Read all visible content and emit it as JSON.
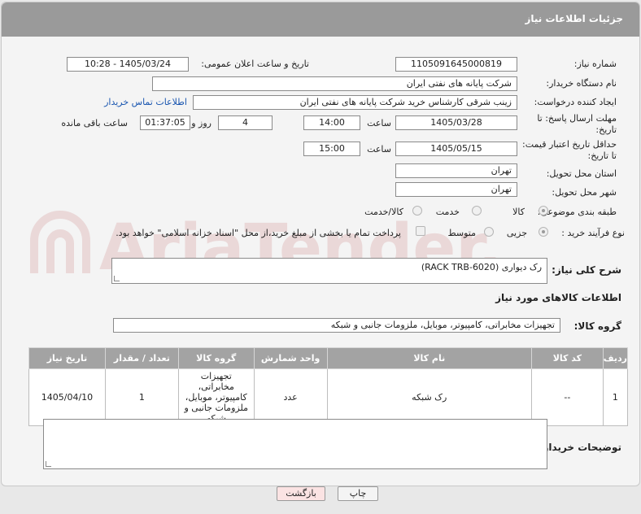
{
  "header": {
    "title": "جزئیات اطلاعات نیاز"
  },
  "fields": {
    "need_number_label": "شماره نیاز:",
    "need_number": "1105091645000819",
    "announce_label": "تاریخ و ساعت اعلان عمومی:",
    "announce_value": "1405/03/24 - 10:28",
    "buyer_label": "نام دستگاه خریدار:",
    "buyer_value": "شرکت پایانه های نفتی ایران",
    "creator_label": "ایجاد کننده درخواست:",
    "creator_value": "زینب  شرقی  کارشناس خرید شرکت پایانه های نفتی ایران",
    "contact_link": "اطلاعات تماس خریدار",
    "deadline_label_1": "مهلت ارسال پاسخ: تا",
    "deadline_label_2": "تاریخ:",
    "deadline_date": "1405/03/28",
    "time_label": "ساعت",
    "deadline_time": "14:00",
    "days_value": "4",
    "days_label": "روز و",
    "remaining_value": "01:37:05",
    "remaining_label": "ساعت باقی مانده",
    "validity_label_1": "حداقل تاریخ اعتبار قیمت:",
    "validity_label_2": "تا تاریخ:",
    "validity_date": "1405/05/15",
    "validity_time": "15:00",
    "province_label": "استان محل تحویل:",
    "province_value": "تهران",
    "city_label": "شهر محل تحویل:",
    "city_value": "تهران",
    "category_label": "طبقه بندی موضوعی:",
    "category_options": [
      "کالا",
      "خدمت",
      "کالا/خدمت"
    ],
    "process_label": "نوع فرآیند خرید :",
    "process_options": [
      "جزیی",
      "متوسط"
    ],
    "payment_note": "پرداخت تمام یا بخشی از مبلغ خرید،از محل \"اسناد خزانه اسلامی\" خواهد بود."
  },
  "description": {
    "label": "شرح کلی نیاز:",
    "value": "رک دیواری (RACK TRB-6020)"
  },
  "goods_section": {
    "title": "اطلاعات کالاهای مورد نیاز",
    "group_label": "گروه کالا:",
    "group_value": "تجهیزات مخابراتی، کامپیوتر، موبایل، ملزومات جانبی و شبکه"
  },
  "table": {
    "headers": [
      "ردیف",
      "کد کالا",
      "نام کالا",
      "واحد شمارش",
      "گروه کالا",
      "تعداد / مقدار",
      "تاریخ نیاز"
    ],
    "rows": [
      {
        "idx": "1",
        "code": "--",
        "name": "رک شبکه",
        "unit": "عدد",
        "group": "تجهیزات مخابراتی، کامپیوتر، موبایل، ملزومات جانبی و شبکه",
        "qty": "1",
        "date": "1405/04/10"
      }
    ]
  },
  "buyer_notes": {
    "label": "توضیحات خریدار:",
    "value": ""
  },
  "buttons": {
    "print": "چاپ",
    "back": "بازگشت"
  },
  "watermark": "AriaTender.net",
  "colors": {
    "header_bg": "#9a9a9a",
    "table_header_bg": "#a3a3a3",
    "link": "#1a56b0",
    "back_button_bg": "#fbe3e3"
  }
}
